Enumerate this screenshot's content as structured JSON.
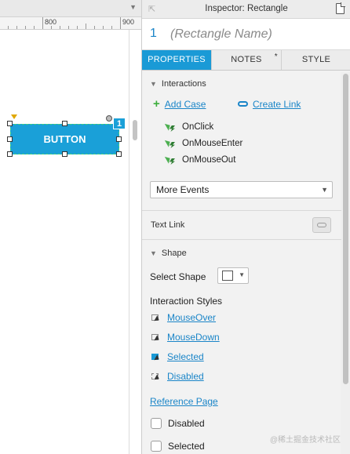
{
  "canvas": {
    "ruler_labels": [
      "800",
      "900"
    ],
    "widget_label": "BUTTON",
    "footnote_number": "1"
  },
  "inspector": {
    "title": "Inspector: Rectangle",
    "widget_number": "1",
    "name_placeholder": "(Rectangle Name)",
    "tabs": [
      {
        "label": "PROPERTIES",
        "active": true
      },
      {
        "label": "NOTES",
        "active": false,
        "marker": "*"
      },
      {
        "label": "STYLE",
        "active": false
      }
    ]
  },
  "interactions": {
    "heading": "Interactions",
    "add_case": "Add Case",
    "create_link": "Create Link",
    "events": [
      "OnClick",
      "OnMouseEnter",
      "OnMouseOut"
    ],
    "more_events": "More Events"
  },
  "text_link": {
    "label": "Text Link"
  },
  "shape": {
    "heading": "Shape",
    "select_shape_label": "Select Shape",
    "interaction_styles_label": "Interaction Styles",
    "styles": [
      "MouseOver",
      "MouseDown",
      "Selected",
      "Disabled"
    ],
    "reference_page": "Reference Page",
    "checkboxes": [
      {
        "label": "Disabled",
        "checked": false
      },
      {
        "label": "Selected",
        "checked": false
      }
    ]
  },
  "watermark": "@稀土掘金技术社区",
  "colors": {
    "accent": "#1a9ad6",
    "link": "#1a85c8",
    "event_icon": "#4caf50"
  }
}
